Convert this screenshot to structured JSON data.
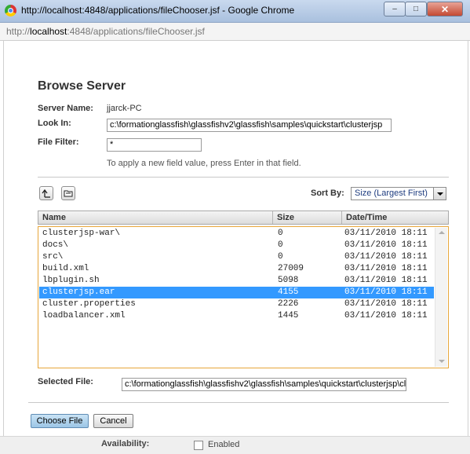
{
  "window": {
    "title": "http://localhost:4848/applications/fileChooser.jsf - Google Chrome",
    "minimize_glyph": "–",
    "maximize_glyph": "□",
    "close_glyph": "✕"
  },
  "urlbar": {
    "prefix": "http://",
    "host": "localhost",
    "rest": ":4848/applications/fileChooser.jsf"
  },
  "page": {
    "title": "Browse Server",
    "server_name_label": "Server Name:",
    "server_name_value": "jjarck-PC",
    "look_in_label": "Look In:",
    "look_in_value": "c:\\formationglassfish\\glassfishv2\\glassfish\\samples\\quickstart\\clusterjsp",
    "file_filter_label": "File Filter:",
    "file_filter_value": "*",
    "hint": "To apply a new field value, press Enter in that field.",
    "up_icon": "folder-up-icon",
    "new_folder_icon": "new-folder-icon",
    "sort_by_label": "Sort By:",
    "sort_by_value": "Size (Largest First)",
    "selected_file_label": "Selected File:",
    "selected_file_value": "c:\\formationglassfish\\glassfishv2\\glassfish\\samples\\quickstart\\clusterjsp\\clusterjsp.ear",
    "choose_button": "Choose File",
    "cancel_button": "Cancel"
  },
  "table": {
    "columns": [
      "Name",
      "Size",
      "Date/Time"
    ],
    "rows": [
      {
        "name": "clusterjsp-war\\",
        "size": "0",
        "date": "03/11/2010 18:11",
        "selected": false
      },
      {
        "name": "docs\\",
        "size": "0",
        "date": "03/11/2010 18:11",
        "selected": false
      },
      {
        "name": "src\\",
        "size": "0",
        "date": "03/11/2010 18:11",
        "selected": false
      },
      {
        "name": "build.xml",
        "size": "27009",
        "date": "03/11/2010 18:11",
        "selected": false
      },
      {
        "name": "lbplugin.sh",
        "size": "5098",
        "date": "03/11/2010 18:11",
        "selected": false
      },
      {
        "name": "clusterjsp.ear",
        "size": "4155",
        "date": "03/11/2010 18:11",
        "selected": true
      },
      {
        "name": "cluster.properties",
        "size": "2226",
        "date": "03/11/2010 18:11",
        "selected": false
      },
      {
        "name": "loadbalancer.xml",
        "size": "1445",
        "date": "03/11/2010 18:11",
        "selected": false
      }
    ]
  },
  "background_page": {
    "availability_label": "Availability:",
    "enabled_label": "Enabled"
  },
  "colors": {
    "selection": "#3399ff",
    "list_border": "#e7a63a",
    "sort_text": "#1f3d80"
  }
}
